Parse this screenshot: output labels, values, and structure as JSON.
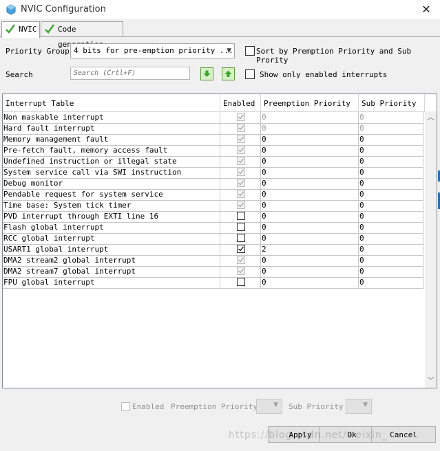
{
  "window": {
    "title": "NVIC Configuration",
    "close_label": "✕"
  },
  "tabs": [
    {
      "label": "NVIC"
    },
    {
      "label": "Code generation"
    }
  ],
  "priority_group": {
    "label": "Priority Group",
    "value": "4 bits for pre-emption priority ...",
    "sort_label": "Sort by Premption Priority and Sub Prority"
  },
  "search": {
    "label": "Search",
    "placeholder": "Search (Crtl+F)",
    "show_enabled_label": "Show only enabled interrupts"
  },
  "table": {
    "headers": [
      "Interrupt Table",
      "Enabled",
      "Preemption Priority",
      "Sub Priority"
    ],
    "rows": [
      {
        "name": "Non maskable interrupt",
        "enabled": true,
        "locked": true,
        "preemption": "0",
        "sub": "0",
        "dim_values": true
      },
      {
        "name": "Hard fault interrupt",
        "enabled": true,
        "locked": true,
        "preemption": "0",
        "sub": "0",
        "dim_values": true
      },
      {
        "name": "Memory management fault",
        "enabled": true,
        "locked": true,
        "preemption": "0",
        "sub": "0",
        "dim_values": false
      },
      {
        "name": "Pre-fetch fault, memory access fault",
        "enabled": true,
        "locked": true,
        "preemption": "0",
        "sub": "0",
        "dim_values": false
      },
      {
        "name": "Undefined instruction or illegal state",
        "enabled": true,
        "locked": true,
        "preemption": "0",
        "sub": "0",
        "dim_values": false
      },
      {
        "name": "System service call via SWI instruction",
        "enabled": true,
        "locked": true,
        "preemption": "0",
        "sub": "0",
        "dim_values": false
      },
      {
        "name": "Debug monitor",
        "enabled": true,
        "locked": true,
        "preemption": "0",
        "sub": "0",
        "dim_values": false
      },
      {
        "name": "Pendable request for system service",
        "enabled": true,
        "locked": true,
        "preemption": "0",
        "sub": "0",
        "dim_values": false
      },
      {
        "name": "Time base: System tick timer",
        "enabled": true,
        "locked": true,
        "preemption": "0",
        "sub": "0",
        "dim_values": false
      },
      {
        "name": "PVD interrupt through EXTI line 16",
        "enabled": false,
        "locked": false,
        "preemption": "0",
        "sub": "0",
        "dim_values": false
      },
      {
        "name": "Flash global interrupt",
        "enabled": false,
        "locked": false,
        "preemption": "0",
        "sub": "0",
        "dim_values": false
      },
      {
        "name": "RCC global interrupt",
        "enabled": false,
        "locked": false,
        "preemption": "0",
        "sub": "0",
        "dim_values": false
      },
      {
        "name": "USART1 global interrupt",
        "enabled": true,
        "locked": false,
        "preemption": "2",
        "sub": "0",
        "dim_values": false
      },
      {
        "name": "DMA2 stream2 global interrupt",
        "enabled": true,
        "locked": true,
        "preemption": "0",
        "sub": "0",
        "dim_values": false
      },
      {
        "name": "DMA2 stream7 global interrupt",
        "enabled": true,
        "locked": true,
        "preemption": "0",
        "sub": "0",
        "dim_values": false
      },
      {
        "name": "FPU global interrupt",
        "enabled": false,
        "locked": false,
        "preemption": "0",
        "sub": "0",
        "dim_values": false
      }
    ]
  },
  "detail": {
    "enabled_label": "Enabled",
    "preemption_label": "Preemption Priority",
    "sub_label": "Sub Priority"
  },
  "buttons": {
    "apply": "Apply",
    "ok": "Ok",
    "cancel": "Cancel"
  },
  "watermark": "https://blog.csdn.net/weixin_",
  "colors": {
    "check_green": "#3aa62b",
    "accent_edge": "#2a6fb0"
  }
}
